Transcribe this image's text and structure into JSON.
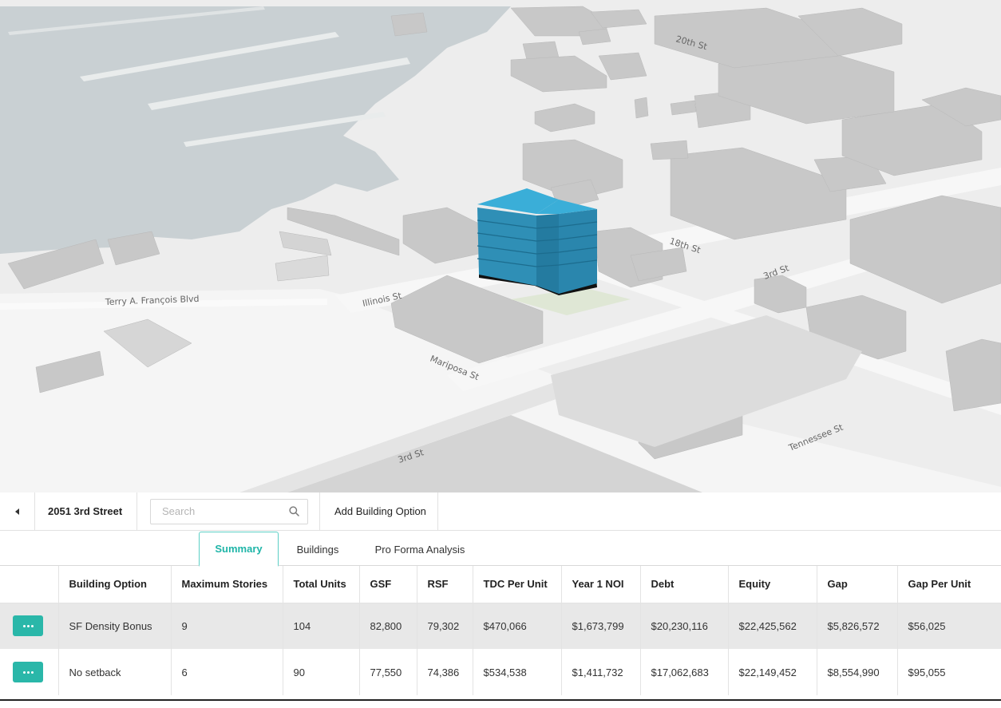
{
  "map": {
    "streets": [
      "20th St",
      "18th St",
      "3rd St",
      "Terry A. François Blvd",
      "Illinois St",
      "Mariposa St",
      "3rd St",
      "Tennessee St"
    ]
  },
  "toolbar": {
    "project_title": "2051 3rd Street",
    "search_placeholder": "Search",
    "add_label": "Add Building Option"
  },
  "tabs": [
    {
      "label": "Summary",
      "active": true
    },
    {
      "label": "Buildings",
      "active": false
    },
    {
      "label": "Pro Forma Analysis",
      "active": false
    }
  ],
  "table": {
    "headers": [
      "Building Option",
      "Maximum Stories",
      "Total Units",
      "GSF",
      "RSF",
      "TDC Per Unit",
      "Year 1 NOI",
      "Debt",
      "Equity",
      "Gap",
      "Gap Per Unit"
    ],
    "rows": [
      [
        "SF Density Bonus",
        "9",
        "104",
        "82,800",
        "79,302",
        "$470,066",
        "$1,673,799",
        "$20,230,116",
        "$22,425,562",
        "$5,826,572",
        "$56,025"
      ],
      [
        "No setback",
        "6",
        "90",
        "77,550",
        "74,386",
        "$534,538",
        "$1,411,732",
        "$17,062,683",
        "$22,149,452",
        "$8,554,990",
        "$95,055"
      ]
    ]
  },
  "colors": {
    "accent": "#2ab7a9",
    "building_highlight": "#3aaed8",
    "water": "#c9d0d3"
  }
}
